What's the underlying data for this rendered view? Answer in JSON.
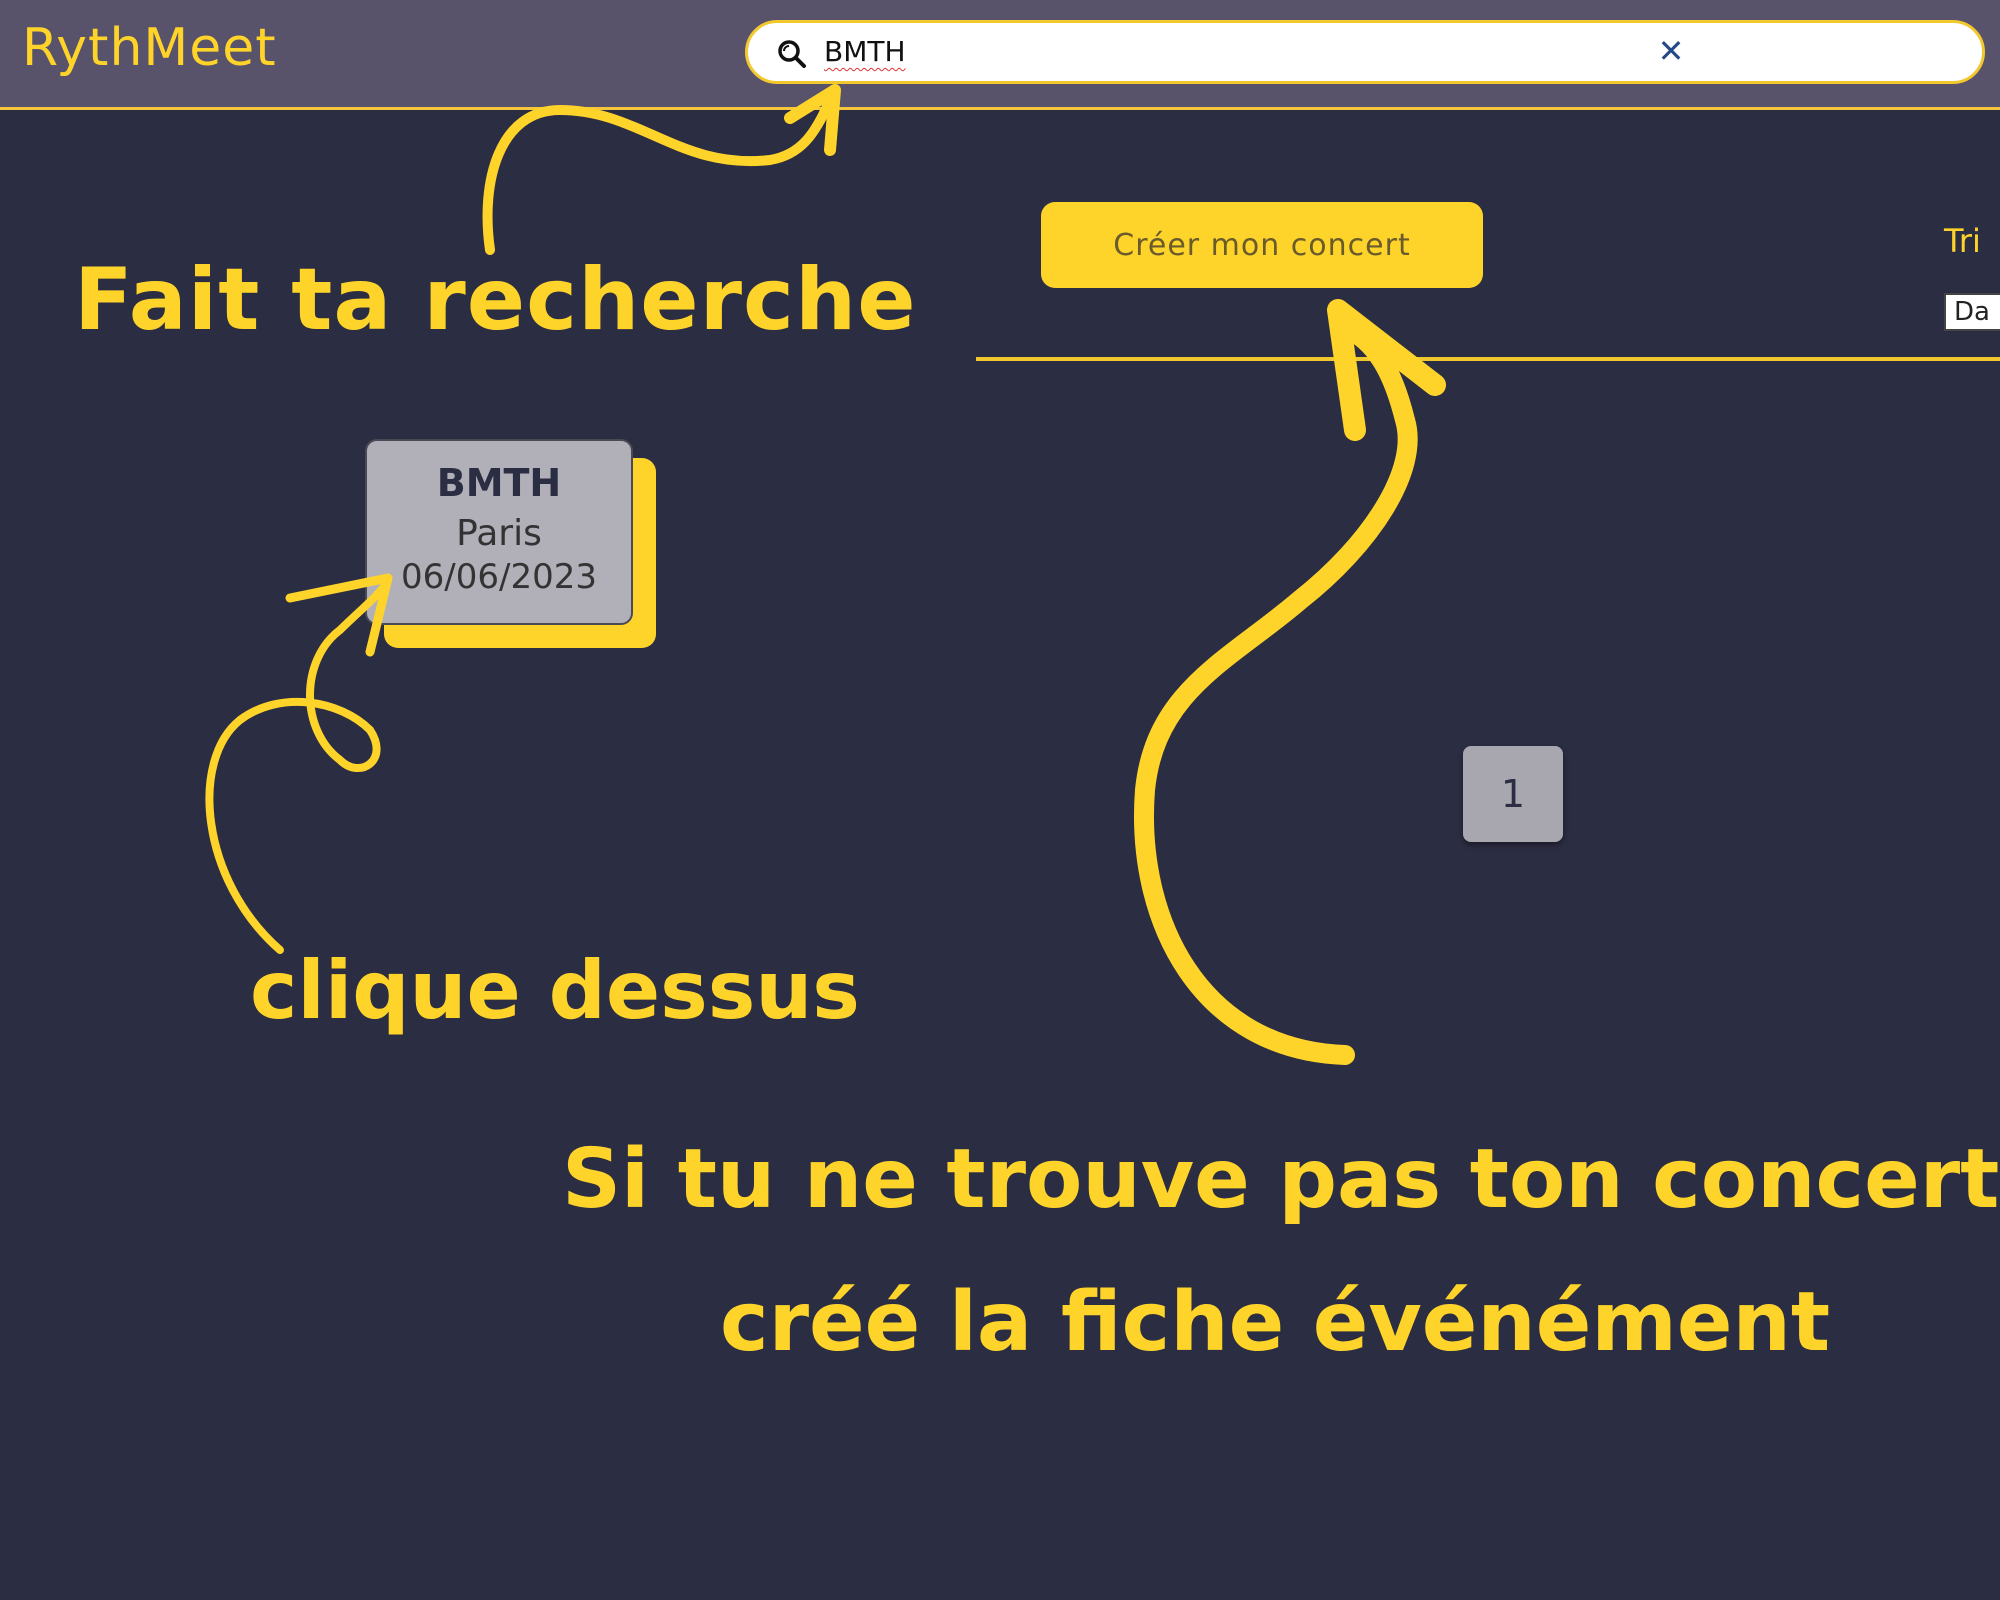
{
  "header": {
    "logo": "RythMeet",
    "search": {
      "value": "BMTH",
      "clear_icon": "close-icon",
      "search_icon": "search-icon"
    }
  },
  "toolbar": {
    "create_label": "Créer mon concert",
    "sort_label": "Tri",
    "sort_selected": "Da"
  },
  "results": [
    {
      "name": "BMTH",
      "city": "Paris",
      "date": "06/06/2023"
    }
  ],
  "pagination": {
    "current_page": "1"
  },
  "annotations": {
    "search_hint": "Fait ta recherche",
    "click_hint": "clique dessus",
    "create_hint_line1": "Si tu ne trouve pas ton concert,",
    "create_hint_line2": "créé la fiche événément"
  },
  "colors": {
    "background": "#2b2d42",
    "header": "#58526a",
    "accent": "#ffd42a",
    "card": "#b1afb8"
  }
}
